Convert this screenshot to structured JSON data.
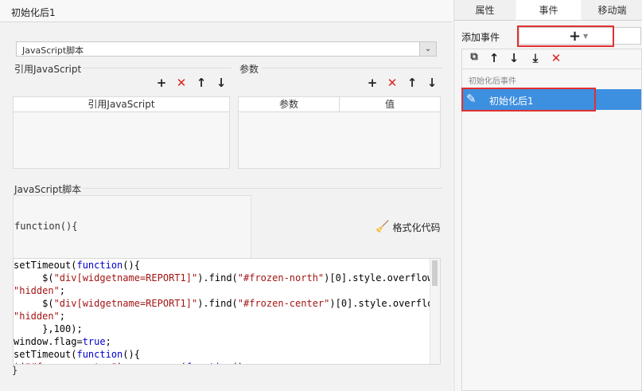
{
  "window": {
    "title": "初始化后1"
  },
  "left": {
    "script_type": "JavaScript脚本",
    "ref_js": {
      "label": "引用JavaScript",
      "column": "引用JavaScript"
    },
    "params": {
      "label": "参数",
      "col_param": "参数",
      "col_value": "值"
    },
    "script_section": {
      "label": "JavaScript脚本",
      "function_header": "function(){",
      "closing": "}"
    },
    "format_button": "格式化代码",
    "code_lines": [
      [
        [
          "setTimeout(",
          ""
        ],
        [
          "function",
          "kw"
        ],
        [
          "(){",
          ""
        ]
      ],
      [
        [
          "     $(",
          ""
        ],
        [
          "\"div[widgetname=REPORT1]\"",
          "str"
        ],
        [
          ").find(",
          ""
        ],
        [
          "\"#frozen-north\"",
          "str"
        ],
        [
          ")[",
          ""
        ],
        [
          "0",
          "num"
        ],
        [
          "].style.overflow=",
          ""
        ]
      ],
      [
        [
          "\"hidden\"",
          "str"
        ],
        [
          ";",
          ""
        ]
      ],
      [
        [
          "     $(",
          ""
        ],
        [
          "\"div[widgetname=REPORT1]\"",
          "str"
        ],
        [
          ").find(",
          ""
        ],
        [
          "\"#frozen-center\"",
          "str"
        ],
        [
          ")[",
          ""
        ],
        [
          "0",
          "num"
        ],
        [
          "].style.overflow=",
          ""
        ]
      ],
      [
        [
          "\"hidden\"",
          "str"
        ],
        [
          ";",
          ""
        ]
      ],
      [
        [
          "     },",
          ""
        ],
        [
          "100",
          "num"
        ],
        [
          ");",
          ""
        ]
      ],
      [
        [
          "window.flag=",
          ""
        ],
        [
          "true",
          "kw"
        ],
        [
          ";",
          ""
        ]
      ],
      [
        [
          "setTimeout(",
          ""
        ],
        [
          "function",
          "kw"
        ],
        [
          "(){",
          ""
        ]
      ],
      [
        [
          "$(",
          ""
        ],
        [
          "\"#frozen-center\"",
          "str"
        ],
        [
          ").mouseover(",
          ""
        ],
        [
          "function",
          "kw"
        ],
        [
          "()",
          ""
        ]
      ]
    ]
  },
  "right": {
    "tabs": [
      "属性",
      "事件",
      "移动端"
    ],
    "active_tab": 1,
    "add_event_label": "添加事件",
    "event_group": "初始化后事件",
    "event_item": "初始化后1"
  },
  "colors": {
    "highlight_border": "#e03030",
    "selected_bg": "#3d8fe0",
    "delete_red": "#e02020"
  }
}
